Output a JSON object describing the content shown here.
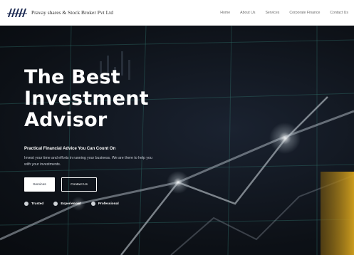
{
  "header": {
    "brand_name": "Pravay shares & Stock Broker Pvt Ltd",
    "nav": [
      "Home",
      "About Us",
      "Services",
      "Corporate Finance",
      "Contact Us"
    ]
  },
  "hero": {
    "title_lines": [
      "The Best",
      "Investment",
      "Advisor"
    ],
    "subtitle": "Practical Financial Advice You Can Count On",
    "description": "Invest your time and efforts in running your business. We are there to help you with your investments.",
    "primary_button": "Services",
    "secondary_button": "Contact Us",
    "badges": [
      "Trusted",
      "Experienced",
      "Professional"
    ]
  },
  "colors": {
    "header_bg": "#ffffff",
    "hero_bg": "#0b0f14",
    "accent_gold": "#c9971c",
    "grid_teal": "#2f6b67"
  }
}
